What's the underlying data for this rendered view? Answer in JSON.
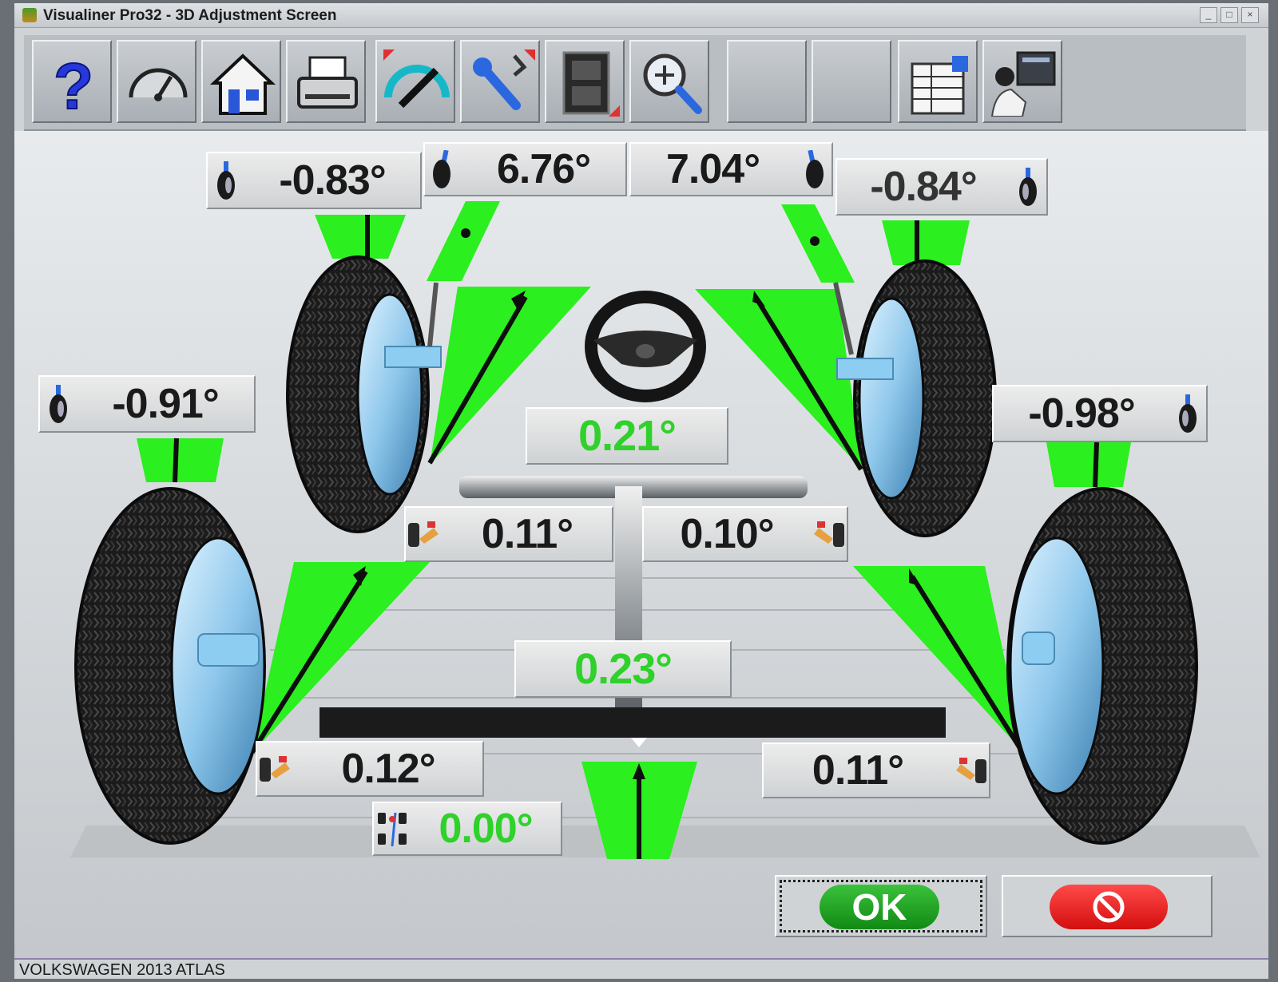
{
  "window": {
    "title": "Visualiner Pro32  -  3D Adjustment Screen",
    "controls": [
      "_",
      "□",
      "×"
    ]
  },
  "toolbar": {
    "buttons": [
      {
        "name": "help-button",
        "icon": "question-mark-icon"
      },
      {
        "name": "gauge-button",
        "icon": "speedometer-icon"
      },
      {
        "name": "home-button",
        "icon": "house-icon"
      },
      {
        "name": "print-button",
        "icon": "printer-icon"
      },
      {
        "name": "measure-button",
        "icon": "protractor-icon"
      },
      {
        "name": "adjust-button",
        "icon": "wrench-icon"
      },
      {
        "name": "film-button",
        "icon": "filmstrip-icon"
      },
      {
        "name": "zoom-button",
        "icon": "magnifier-icon"
      },
      {
        "name": "blank-button-1",
        "icon": ""
      },
      {
        "name": "blank-button-2",
        "icon": ""
      },
      {
        "name": "spec-sheet-button",
        "icon": "spreadsheet-icon"
      },
      {
        "name": "technician-button",
        "icon": "technician-icon"
      }
    ]
  },
  "readings": {
    "front_left_camber": "-0.83°",
    "front_left_caster": "6.76°",
    "front_right_caster": "7.04°",
    "front_right_camber": "-0.84°",
    "rear_left_camber": "-0.91°",
    "rear_right_camber": "-0.98°",
    "front_total_toe": "0.21°",
    "front_left_toe": "0.11°",
    "front_right_toe": "0.10°",
    "rear_total_toe": "0.23°",
    "rear_left_toe": "0.12°",
    "rear_right_toe": "0.11°",
    "thrust_angle": "0.00°"
  },
  "colors": {
    "indicator_green": "#2bef1f",
    "value_green": "#2fd12a",
    "ok_green": "#1fa322",
    "cancel_red": "#e51c1c"
  },
  "buttons": {
    "ok_label": "OK",
    "cancel_icon": "no-entry-icon"
  },
  "statusbar": {
    "text": "VOLKSWAGEN 2013 ATLAS"
  }
}
